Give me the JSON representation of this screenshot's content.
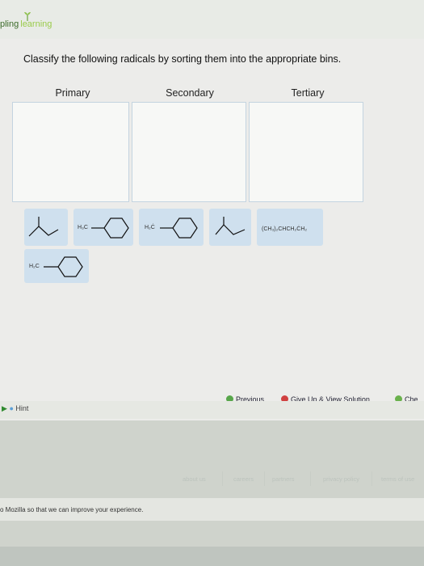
{
  "brand": {
    "part1": "pling",
    "part2": "learning"
  },
  "question": "Classify the following radicals by sorting them into the appropriate bins.",
  "bins": [
    {
      "label": "Primary"
    },
    {
      "label": "Secondary"
    },
    {
      "label": "Tertiary"
    }
  ],
  "tiles": {
    "t2_label": "H₃C",
    "t3_label": "H₂Ċ",
    "t5_label": "(CH₃)₂CHCH₂ĊH₂",
    "t6_label": "H₂C"
  },
  "hint": "Hint",
  "nav": {
    "previous": "Previous",
    "give_up": "Give Up & View Solution",
    "check": "Che"
  },
  "footer": {
    "links": [
      "about us",
      "careers",
      "partners",
      "privacy policy",
      "terms of use"
    ]
  },
  "notice": "o Mozilla so that we can improve your experience."
}
